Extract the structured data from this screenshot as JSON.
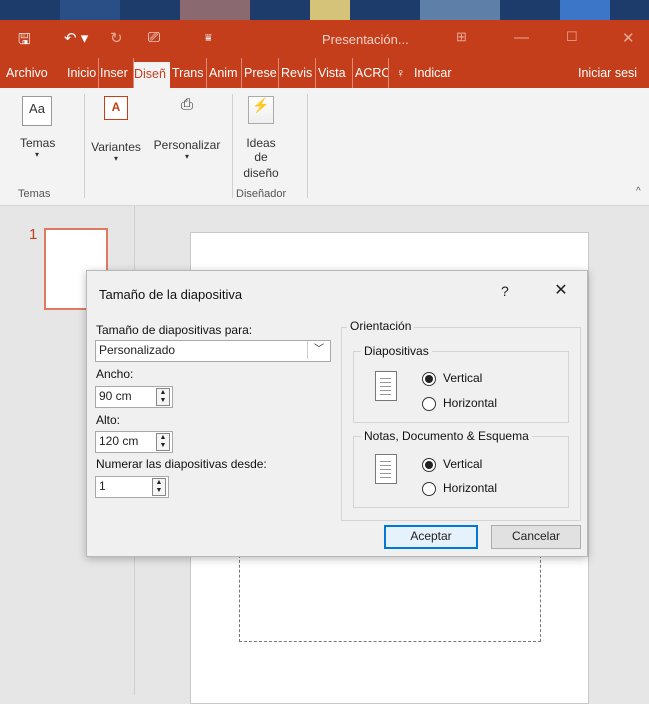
{
  "titlebar": {
    "title": "Presentación...",
    "icons": [
      "save-icon",
      "undo-icon",
      "redo-icon",
      "present-icon",
      "customize-icon",
      "restore-icon",
      "minimize-icon",
      "maximize-icon",
      "close-icon"
    ]
  },
  "tabs": [
    "Archivo",
    "Inicio",
    "Insertar",
    "Diseño",
    "Transiciones",
    "Animaciones",
    "Presentación",
    "Revisar",
    "Vista",
    "ACROBAT",
    "Indicar",
    "Iniciar sesión"
  ],
  "tab_display": [
    "Archivo",
    "Inicio",
    "Inser",
    "Diseñ",
    "Trans",
    "Anim",
    "Prese",
    "Revis",
    "Vista",
    "ACRO",
    "Indicar",
    "Iniciar sesi"
  ],
  "ribbon": {
    "temas": "Temas",
    "variantes": "Variantes",
    "personalizar": "Personalizar",
    "ideas_line1": "Ideas de",
    "ideas_line2": "diseño",
    "group_temas": "Temas",
    "group_disenador": "Diseñador"
  },
  "slides": {
    "number": "1"
  },
  "dialog": {
    "title": "Tamaño de la diapositiva",
    "help": "?",
    "close": "✕",
    "size_for_label": "Tamaño de diapositivas para:",
    "size_for_value": "Personalizado",
    "width_label": "Ancho:",
    "width_value": "90 cm",
    "height_label": "Alto:",
    "height_value": "120 cm",
    "number_from_label": "Numerar las diapositivas desde:",
    "number_from_value": "1",
    "orientation_label": "Orientación",
    "slides_group": "Diapositivas",
    "slides_vertical": "Vertical",
    "slides_horizontal": "Horizontal",
    "notes_group": "Notas, Documento & Esquema",
    "notes_vertical": "Vertical",
    "notes_horizontal": "Horizontal",
    "ok": "Aceptar",
    "cancel": "Cancelar"
  },
  "colors": {
    "accent": "#c43e1c",
    "primary_button_border": "#0078d7"
  }
}
